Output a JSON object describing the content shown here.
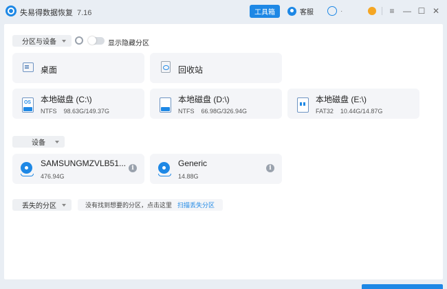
{
  "app": {
    "title": "失易得数据恢复",
    "version": "7.16",
    "toolbox_label": "工具箱",
    "support_label": "客服",
    "dot_label": "·"
  },
  "window_controls": {
    "menu": "≡",
    "minimize": "—",
    "maximize": "☐",
    "close": "✕"
  },
  "partitions_section": {
    "dropdown_label": "分区与设备",
    "toggle_label": "显示隐藏分区",
    "toggle_on": false,
    "quick_locations": [
      {
        "name": "桌面",
        "icon": "desktop-icon"
      },
      {
        "name": "回收站",
        "icon": "recycle-bin-icon"
      }
    ],
    "drives": [
      {
        "name": "本地磁盘 (C:\\)",
        "fs": "NTFS",
        "usage": "98.63G/149.37G",
        "icon": "system-drive-icon",
        "badge": "OS"
      },
      {
        "name": "本地磁盘 (D:\\)",
        "fs": "NTFS",
        "usage": "66.98G/326.94G",
        "icon": "drive-icon"
      },
      {
        "name": "本地磁盘 (E:\\)",
        "fs": "FAT32",
        "usage": "10.44G/14.87G",
        "icon": "usb-drive-icon"
      }
    ]
  },
  "devices_section": {
    "dropdown_label": "设备",
    "devices": [
      {
        "name": "SAMSUNGMZVLB51...",
        "size": "476.94G",
        "icon": "disk-icon"
      },
      {
        "name": "Generic",
        "size": "14.88G",
        "icon": "disk-icon"
      }
    ]
  },
  "lost_section": {
    "dropdown_label": "丢失的分区",
    "hint_text": "没有找到想要的分区，点击这里",
    "hint_link": "扫描丢失分区"
  },
  "colors": {
    "accent": "#1e88e5",
    "card_bg": "#f4f5f8",
    "window_bg": "#e9eef4"
  }
}
